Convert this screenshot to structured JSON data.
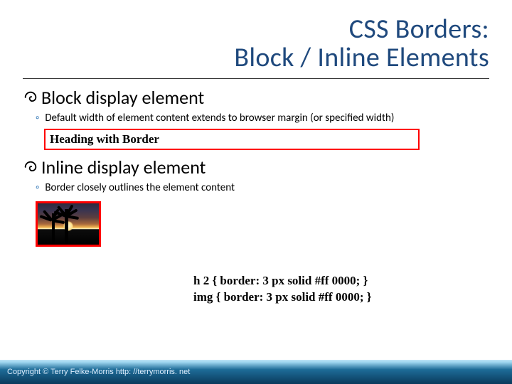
{
  "title": {
    "line1": "CSS Borders:",
    "line2": "Block / Inline Elements"
  },
  "section1": {
    "heading": "Block display element",
    "sub": "Default width of element content extends to browser margin (or specified width)",
    "example_text": "Heading with Border"
  },
  "section2": {
    "heading": "Inline  display element",
    "sub": "Border closely outlines the element content"
  },
  "code": {
    "line1": "h 2 { border: 3 px solid #ff 0000; }",
    "line2": "img { border: 3 px solid #ff 0000; }"
  },
  "footer": "Copyright © Terry Felke-Morris http: //terrymorris. net",
  "sub_bullet_marker": "◦"
}
